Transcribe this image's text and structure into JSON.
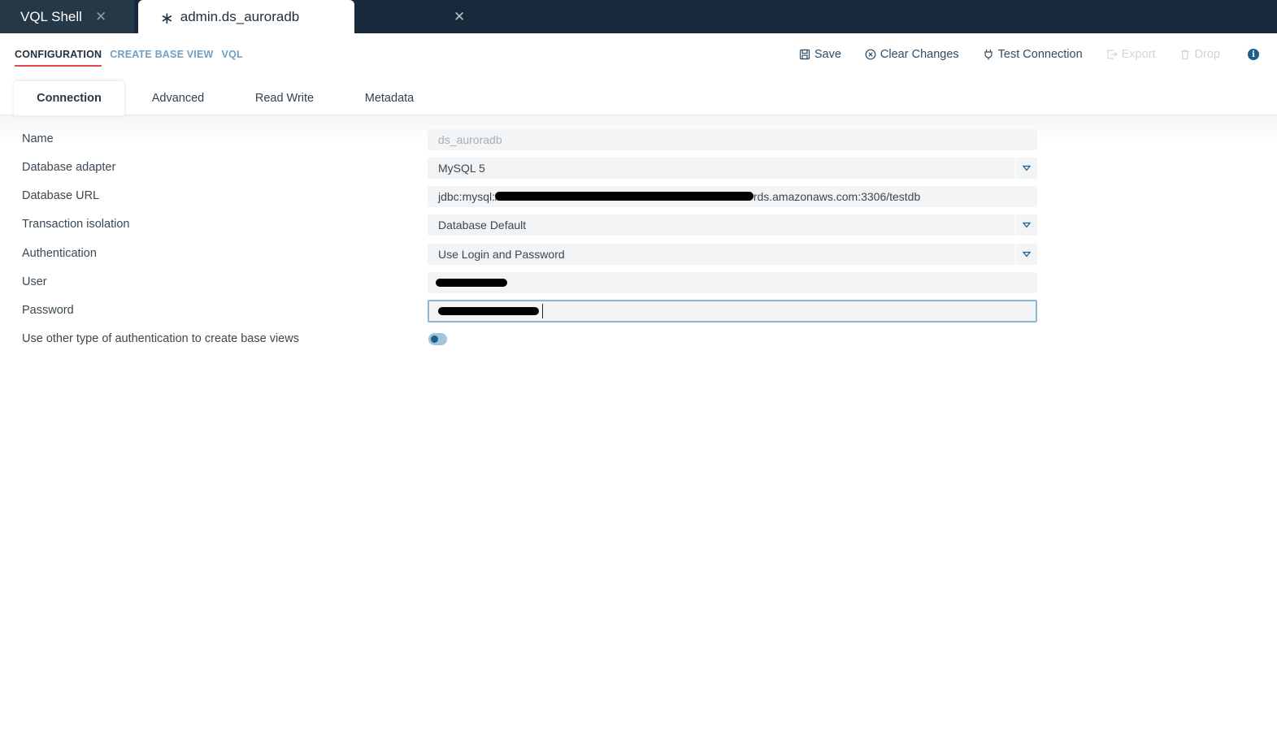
{
  "window_tabs": [
    {
      "label": "VQL Shell",
      "close": "✕"
    },
    {
      "label": "admin.ds_auroradb",
      "modified": "∗",
      "close": "✕"
    }
  ],
  "subnav": [
    "CONFIGURATION",
    "CREATE BASE VIEW",
    "VQL"
  ],
  "toolbar": {
    "save": "Save",
    "clear": "Clear Changes",
    "test": "Test Connection",
    "export": "Export",
    "drop": "Drop",
    "info": "i"
  },
  "tabs": [
    "Connection",
    "Advanced",
    "Read Write",
    "Metadata"
  ],
  "form": {
    "name_label": "Name",
    "name_value": "ds_auroradb",
    "adapter_label": "Database adapter",
    "adapter_value": "MySQL 5",
    "url_label": "Database URL",
    "url_prefix": "jdbc:mysql://",
    "url_suffix": "rds.amazonaws.com:3306/testdb",
    "isolation_label": "Transaction isolation",
    "isolation_value": "Database Default",
    "auth_label": "Authentication",
    "auth_value": "Use Login and Password",
    "user_label": "User",
    "password_label": "Password",
    "other_auth_label": "Use other type of authentication to create base views",
    "other_auth_enabled": false
  },
  "colors": {
    "topbar": "#17293a",
    "accent": "#1d5f8c",
    "active_underline": "#e04b4b",
    "link": "#6fa0c2"
  }
}
